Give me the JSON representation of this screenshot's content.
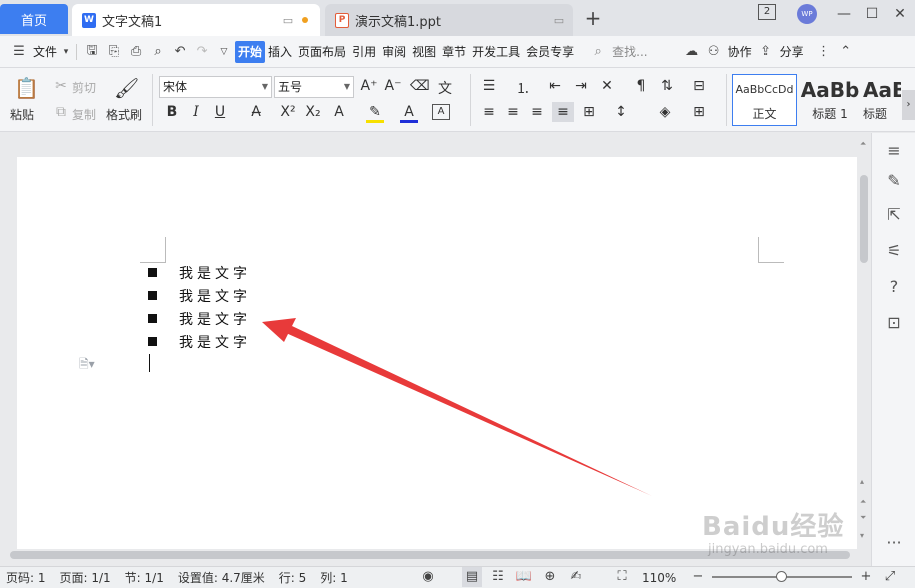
{
  "titlebar": {
    "home_tab": "首页",
    "tabs": [
      {
        "label": "文字文稿1",
        "icon": "W"
      },
      {
        "label": "演示文稿1.ppt",
        "icon": "P"
      }
    ],
    "add_tab": "+",
    "badge": "2",
    "avatar": "WP"
  },
  "menubar": {
    "file": "文件",
    "items": [
      "开始",
      "插入",
      "页面布局",
      "引用",
      "审阅",
      "视图",
      "章节",
      "开发工具",
      "会员专享"
    ],
    "search": "查找...",
    "collab": "协作",
    "share": "分享"
  },
  "ribbon": {
    "paste": "粘贴",
    "cut": "剪切",
    "copy": "复制",
    "format_painter": "格式刷",
    "font_name": "宋体",
    "font_size": "五号",
    "styles": [
      {
        "sample": "AaBbCcDd",
        "name": "正文"
      },
      {
        "sample": "AaBb",
        "name": "标题 1"
      },
      {
        "sample": "AaBl",
        "name": "标题"
      }
    ]
  },
  "document": {
    "list_items": [
      "我是文字",
      "我是文字",
      "我是文字",
      "我是文字"
    ]
  },
  "statusbar": {
    "page_num": "页码: 1",
    "page": "页面: 1/1",
    "section": "节: 1/1",
    "setting": "设置值: 4.7厘米",
    "row": "行: 5",
    "col": "列: 1",
    "zoom": "110%"
  },
  "watermark": {
    "brand": "Baidu经验",
    "url": "jingyan.baidu.com"
  },
  "colors": {
    "accent": "#3d7ef0",
    "arrow": "#e83a3a"
  }
}
